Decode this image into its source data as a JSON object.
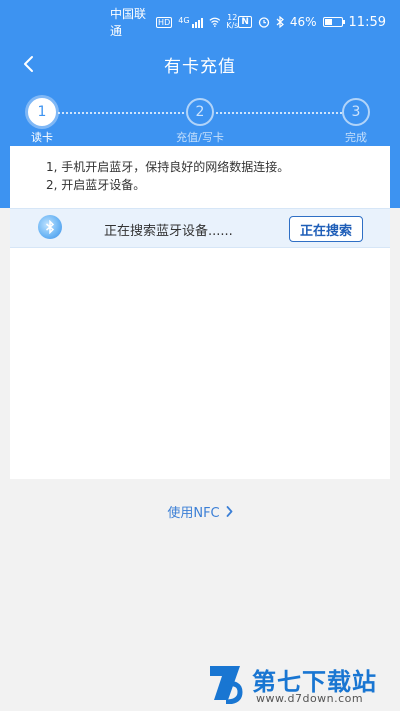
{
  "status_bar": {
    "carrier": "中国联通",
    "hd_badge": "HD",
    "network_badge": "4G",
    "speed_value": "12",
    "speed_unit": "K/s",
    "nfc_glyph": "N",
    "battery_percent": "46%",
    "battery_level": 0.46,
    "time": "11:59",
    "icons": [
      "hd-icon",
      "signal-icon",
      "wifi-icon",
      "nfc-icon",
      "alarm-icon",
      "bluetooth-icon",
      "battery-icon"
    ]
  },
  "nav": {
    "title": "有卡充值",
    "back_icon": "chevron-left-icon"
  },
  "steps": [
    {
      "number": "1",
      "label": "读卡",
      "active": true
    },
    {
      "number": "2",
      "label": "充值/写卡",
      "active": false
    },
    {
      "number": "3",
      "label": "完成",
      "active": false
    }
  ],
  "instructions": [
    "1, 手机开启蓝牙，保持良好的网络数据连接。",
    "2, 开启蓝牙设备。"
  ],
  "search": {
    "icon": "bluetooth-device-icon",
    "status_text": "正在搜索蓝牙设备......",
    "button_label": "正在搜索"
  },
  "nfc": {
    "label": "使用NFC",
    "icon": "chevron-right-icon"
  },
  "watermark": {
    "title": "第七下载站",
    "url": "www.d7down.com"
  },
  "colors": {
    "primary": "#3d93f1",
    "button_border": "#2f6fc5",
    "link": "#3b7fd6",
    "background": "#f2f2f2"
  }
}
